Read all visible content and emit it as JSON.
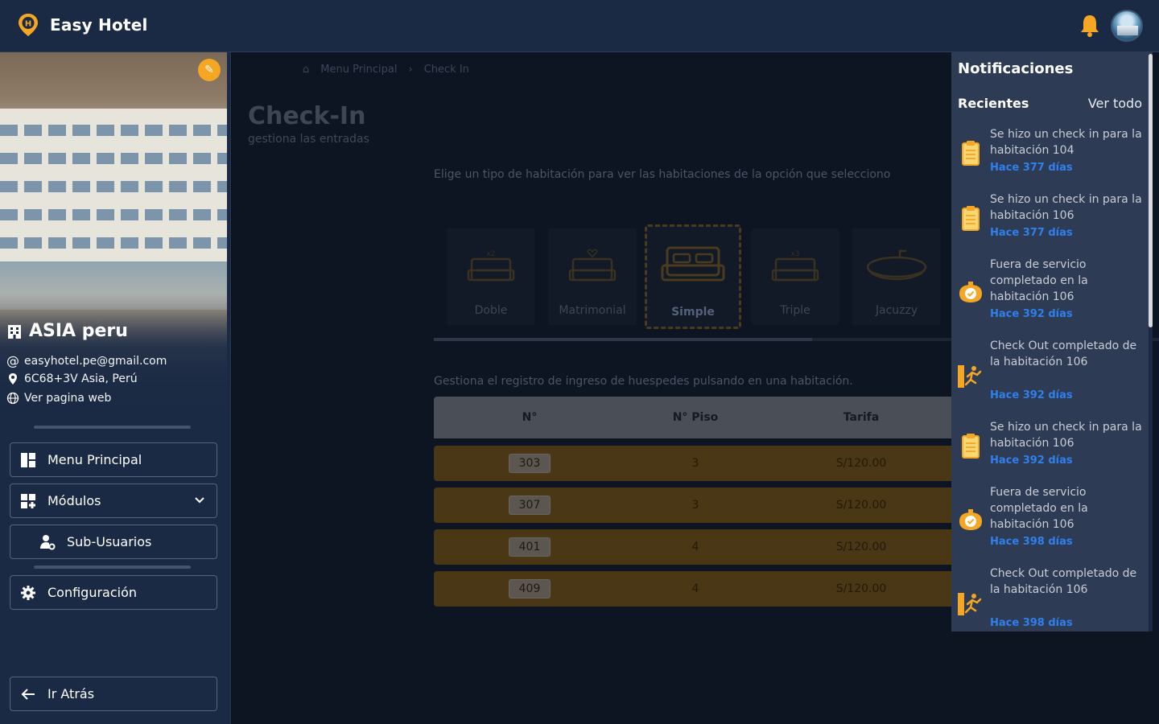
{
  "app": {
    "name": "Easy Hotel"
  },
  "hotel": {
    "name": "ASIA peru",
    "email": "easyhotel.pe@gmail.com",
    "address": "6C68+3V Asia, Perú",
    "website_link": "Ver pagina web"
  },
  "sidebar": {
    "menu_principal": "Menu Principal",
    "modulos": "Módulos",
    "sub_usuarios": "Sub-Usuarios",
    "configuracion": "Configuración",
    "ir_atras": "Ir Atrás"
  },
  "breadcrumb": {
    "home": "Menu Principal",
    "current": "Check In"
  },
  "page": {
    "title": "Check-In",
    "subtitle": "gestiona las entradas",
    "choose_text": "Elige un tipo de habitación para ver las habitaciones de la opción que selecciono",
    "manage_text": "Gestiona el registro de ingreso de huespedes pulsando en una habitación."
  },
  "room_types": [
    {
      "label": "Doble",
      "icon": "bed-x2-icon"
    },
    {
      "label": "Matrimonial",
      "icon": "bed-heart-icon"
    },
    {
      "label": "Simple",
      "icon": "single-bed-icon",
      "selected": true
    },
    {
      "label": "Triple",
      "icon": "bed-x3-icon"
    },
    {
      "label": "Jacuzzy",
      "icon": "jacuzzi-icon"
    }
  ],
  "table": {
    "headers": [
      "N°",
      "N° Piso",
      "Tarifa"
    ],
    "rows": [
      {
        "num": "303",
        "floor": "3",
        "rate": "S/120.00"
      },
      {
        "num": "307",
        "floor": "3",
        "rate": "S/120.00"
      },
      {
        "num": "401",
        "floor": "4",
        "rate": "S/120.00"
      },
      {
        "num": "409",
        "floor": "4",
        "rate": "S/120.00"
      }
    ]
  },
  "notifications": {
    "title": "Notificaciones",
    "recent_label": "Recientes",
    "view_all": "Ver todo",
    "items": [
      {
        "text": "Se hizo un check in para la habitación 104",
        "time": "Hace 377 días",
        "icon": "clipboard-icon"
      },
      {
        "text": "Se hizo un check in para la habitación 106",
        "time": "Hace 377 días",
        "icon": "clipboard-icon"
      },
      {
        "text": "Fuera de servicio completado en la habitación 106",
        "time": "Hace 392 días",
        "icon": "service-done-icon"
      },
      {
        "text": "Check Out completado de la habitación 106",
        "time": "Hace 392 días",
        "icon": "exit-icon"
      },
      {
        "text": "Se hizo un check in para la habitación 106",
        "time": "Hace 392 días",
        "icon": "clipboard-icon"
      },
      {
        "text": "Fuera de servicio completado en la habitación 106",
        "time": "Hace 398 días",
        "icon": "service-done-icon"
      },
      {
        "text": "Check Out completado de la habitación 106",
        "time": "Hace 398 días",
        "icon": "exit-icon"
      }
    ]
  },
  "colors": {
    "accent": "#F5A623",
    "topbar": "#1B2A44",
    "link": "#2F80ED"
  }
}
